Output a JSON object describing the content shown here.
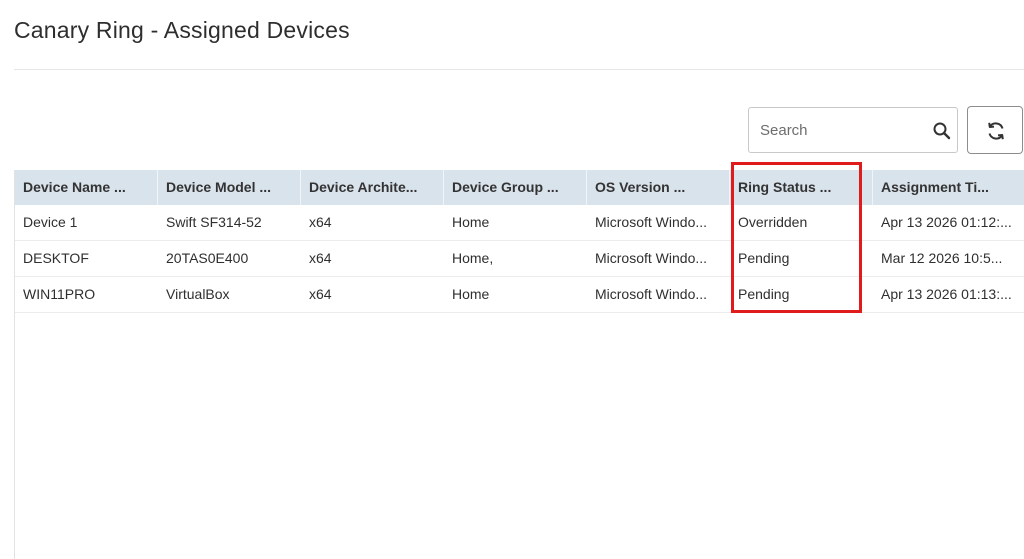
{
  "page": {
    "title": "Canary Ring - Assigned Devices"
  },
  "search": {
    "placeholder": "Search",
    "value": ""
  },
  "table": {
    "columns": [
      "Device Name ...",
      "Device Model ...",
      "Device Archite...",
      "Device Group ...",
      "OS Version ...",
      "Ring Status ...",
      "Assignment Ti..."
    ],
    "rows": [
      [
        "Device 1",
        "Swift SF314-52",
        "x64",
        "Home",
        "Microsoft Windo...",
        "Overridden",
        "Apr 13 2026 01:12:..."
      ],
      [
        "DESKTOF",
        "20TAS0E400",
        "x64",
        "Home,",
        "Microsoft Windo...",
        "Pending",
        "Mar 12 2026 10:5..."
      ],
      [
        "WIN11PRO",
        "VirtualBox",
        "x64",
        "Home",
        "Microsoft Windo...",
        "Pending",
        "Apr 13 2026 01:13:..."
      ]
    ]
  },
  "colors": {
    "header_bg": "#d9e3ec",
    "highlight": "#e01b1b"
  }
}
